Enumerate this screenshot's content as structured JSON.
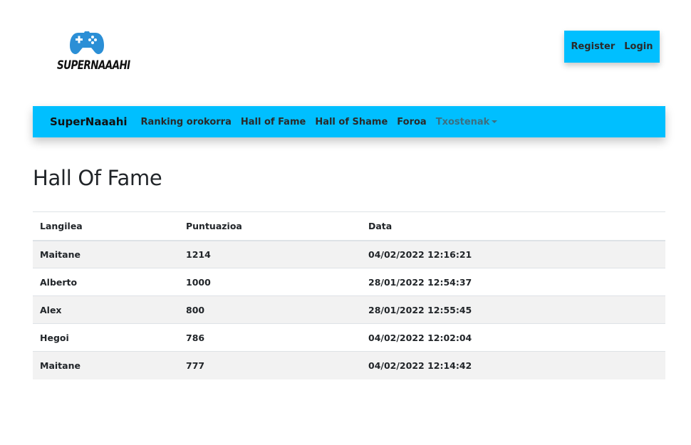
{
  "logo": {
    "icon": "gamepad-icon",
    "text": "SUPERNAAAHI",
    "color": "#2b8fd6"
  },
  "auth": {
    "register_label": "Register",
    "login_label": "Login"
  },
  "navbar": {
    "brand": "SuperNaaahi",
    "items": [
      {
        "label": "Ranking orokorra"
      },
      {
        "label": "Hall of Fame"
      },
      {
        "label": "Hall of Shame"
      },
      {
        "label": "Foroa"
      },
      {
        "label": "Txostenak",
        "dropdown": true
      }
    ],
    "background": "#00bfff"
  },
  "page": {
    "title": "Hall Of Fame"
  },
  "table": {
    "headers": [
      "Langilea",
      "Puntuazioa",
      "Data"
    ],
    "rows": [
      [
        "Maitane",
        "1214",
        "04/02/2022 12:16:21"
      ],
      [
        "Alberto",
        "1000",
        "28/01/2022 12:54:37"
      ],
      [
        "Alex",
        "800",
        "28/01/2022 12:55:45"
      ],
      [
        "Hegoi",
        "786",
        "04/02/2022 12:02:04"
      ],
      [
        "Maitane",
        "777",
        "04/02/2022 12:14:42"
      ]
    ]
  }
}
